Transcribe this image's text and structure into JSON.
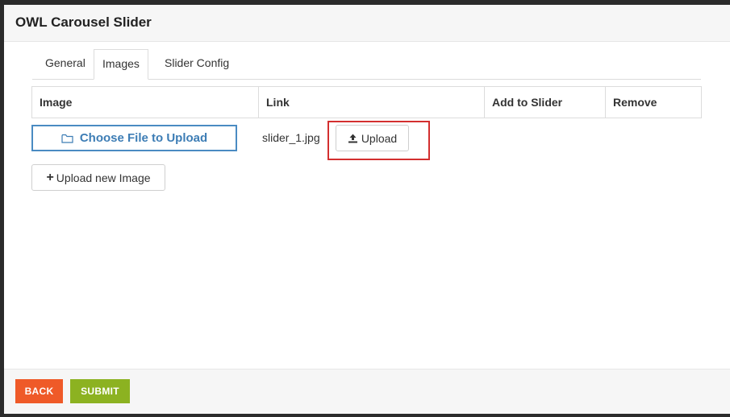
{
  "window": {
    "title": "OWL Carousel Slider"
  },
  "tabs": [
    {
      "label": "General"
    },
    {
      "label": "Images",
      "active": true
    },
    {
      "label": "Slider Config"
    }
  ],
  "table": {
    "columns": [
      "Image",
      "Link",
      "Add to Slider",
      "Remove"
    ]
  },
  "row": {
    "choose_label": "Choose File to Upload",
    "choose_icon": "folder-icon",
    "filename": "slider_1.jpg",
    "upload_label": "Upload",
    "upload_icon": "upload-icon"
  },
  "add_new": {
    "label": "Upload new Image",
    "icon": "plus-icon"
  },
  "footer": {
    "back_label": "BACK",
    "submit_label": "SUBMIT"
  },
  "colors": {
    "accent_blue": "#3d7db5",
    "highlight_red": "#d32f2f",
    "back_orange": "#ef5a28",
    "submit_green": "#8cb221"
  }
}
